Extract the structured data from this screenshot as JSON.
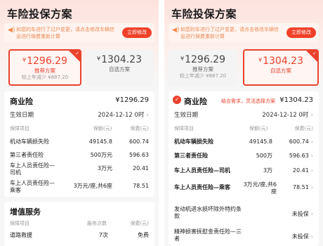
{
  "colors": {
    "accent": "#e9422c",
    "notice_text": "#e98a55",
    "background": "#f6f6f6"
  },
  "left": {
    "title": "车险投保方案",
    "notice": {
      "icon": "speaker-icon",
      "text": "如您的车进行了过户变更，请点击修改车辆信息进行保费重新计算",
      "button": "立即修改"
    },
    "cards": [
      {
        "price": "1296.29",
        "yen": "¥",
        "label": "推荐方案",
        "compare": "较上年减少 ¥887.20",
        "selected": true
      },
      {
        "price": "1304.23",
        "yen": "¥",
        "label": "自选方案",
        "selected": false
      }
    ],
    "commercial": {
      "title": "商业险",
      "total": "¥1296.29",
      "effective_label": "生效日期",
      "effective_date": "2024-12-12 0时",
      "header": {
        "item": "保障项目",
        "amount": "保额(元)",
        "premium": "保费(元)"
      },
      "rows": [
        {
          "name": "机动车辆损失险",
          "amount": "49145.8",
          "premium": "600.74"
        },
        {
          "name": "第三者责任险",
          "amount": "500万元",
          "premium": "596.63"
        },
        {
          "name": "车上人员责任险—司机",
          "amount": "3万元",
          "premium": "20.41"
        },
        {
          "name": "车上人员责任险—乘客",
          "amount": "3万元/座,共6座",
          "premium": "78.51"
        }
      ]
    },
    "added": {
      "title": "增值服务",
      "header": {
        "item": "保障项目",
        "count": "服务次数",
        "premium": "保费(元)"
      },
      "rows": [
        {
          "name": "道路救援",
          "count": "7次",
          "premium": "免费"
        }
      ]
    }
  },
  "right": {
    "title": "车险投保方案",
    "notice": {
      "icon": "speaker-icon",
      "text": "如您的车进行了过户变更，请点击修改车辆信息进行保费重新计算",
      "button": "立即修改"
    },
    "cards": [
      {
        "price": "1296.29",
        "yen": "¥",
        "label": "推荐方案",
        "compare": "较上年减少 ¥887.20",
        "selected": false
      },
      {
        "price": "1304.23",
        "yen": "¥",
        "label": "自选方案",
        "selected": true
      }
    ],
    "commercial": {
      "title": "商业险",
      "tag": "结合需求，灵活选择方案",
      "total": "¥1304.23",
      "effective_label": "生效日期",
      "effective_date": "2024-12-12 0时",
      "header": {
        "item": "保障项目",
        "amount": "保额(元)",
        "premium": "保费(元)"
      },
      "rows": [
        {
          "name": "机动车辆损失险",
          "amount": "49145.8",
          "premium": "600.74"
        },
        {
          "name": "第三者责任险",
          "amount": "500万",
          "premium": "596.63"
        },
        {
          "name": "车上人员责任险—司机",
          "amount": "3万",
          "premium": "20.41"
        },
        {
          "name": "车上人员责任险—乘客",
          "amount": "3万元/座,共6座",
          "premium": "78.51"
        },
        {
          "name": "发动机进水损坏除外特约条款",
          "amount": "",
          "premium": "未投保"
        },
        {
          "name": "精神损害抚慰金责任险—三者",
          "amount": "",
          "premium": "未投保"
        }
      ]
    }
  }
}
